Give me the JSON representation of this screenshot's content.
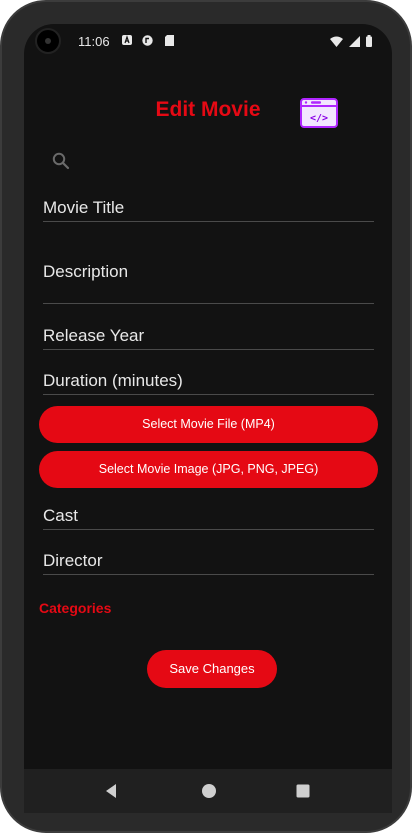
{
  "status_bar": {
    "time": "11:06",
    "icons": [
      "a-letter-icon",
      "app-badge-icon",
      "sd-card-icon",
      "wifi-icon",
      "signal-icon",
      "battery-icon"
    ]
  },
  "header": {
    "title": "Edit Movie",
    "debug_icon": "code-window-icon"
  },
  "form": {
    "search_icon": "search-icon",
    "movie_title": "Movie Title",
    "description": "Description",
    "release_year": "Release Year",
    "duration": "Duration (minutes)",
    "select_file_label": "Select Movie File (MP4)",
    "select_image_label": "Select Movie Image (JPG, PNG, JPEG)",
    "cast": "Cast",
    "director": "Director",
    "categories_label": "Categories",
    "save_label": "Save Changes"
  },
  "nav": {
    "back": "back-icon",
    "home": "home-icon",
    "recents": "recents-icon"
  },
  "colors": {
    "accent": "#e50914",
    "background": "#121212",
    "debug_icon": "#b026ff"
  }
}
